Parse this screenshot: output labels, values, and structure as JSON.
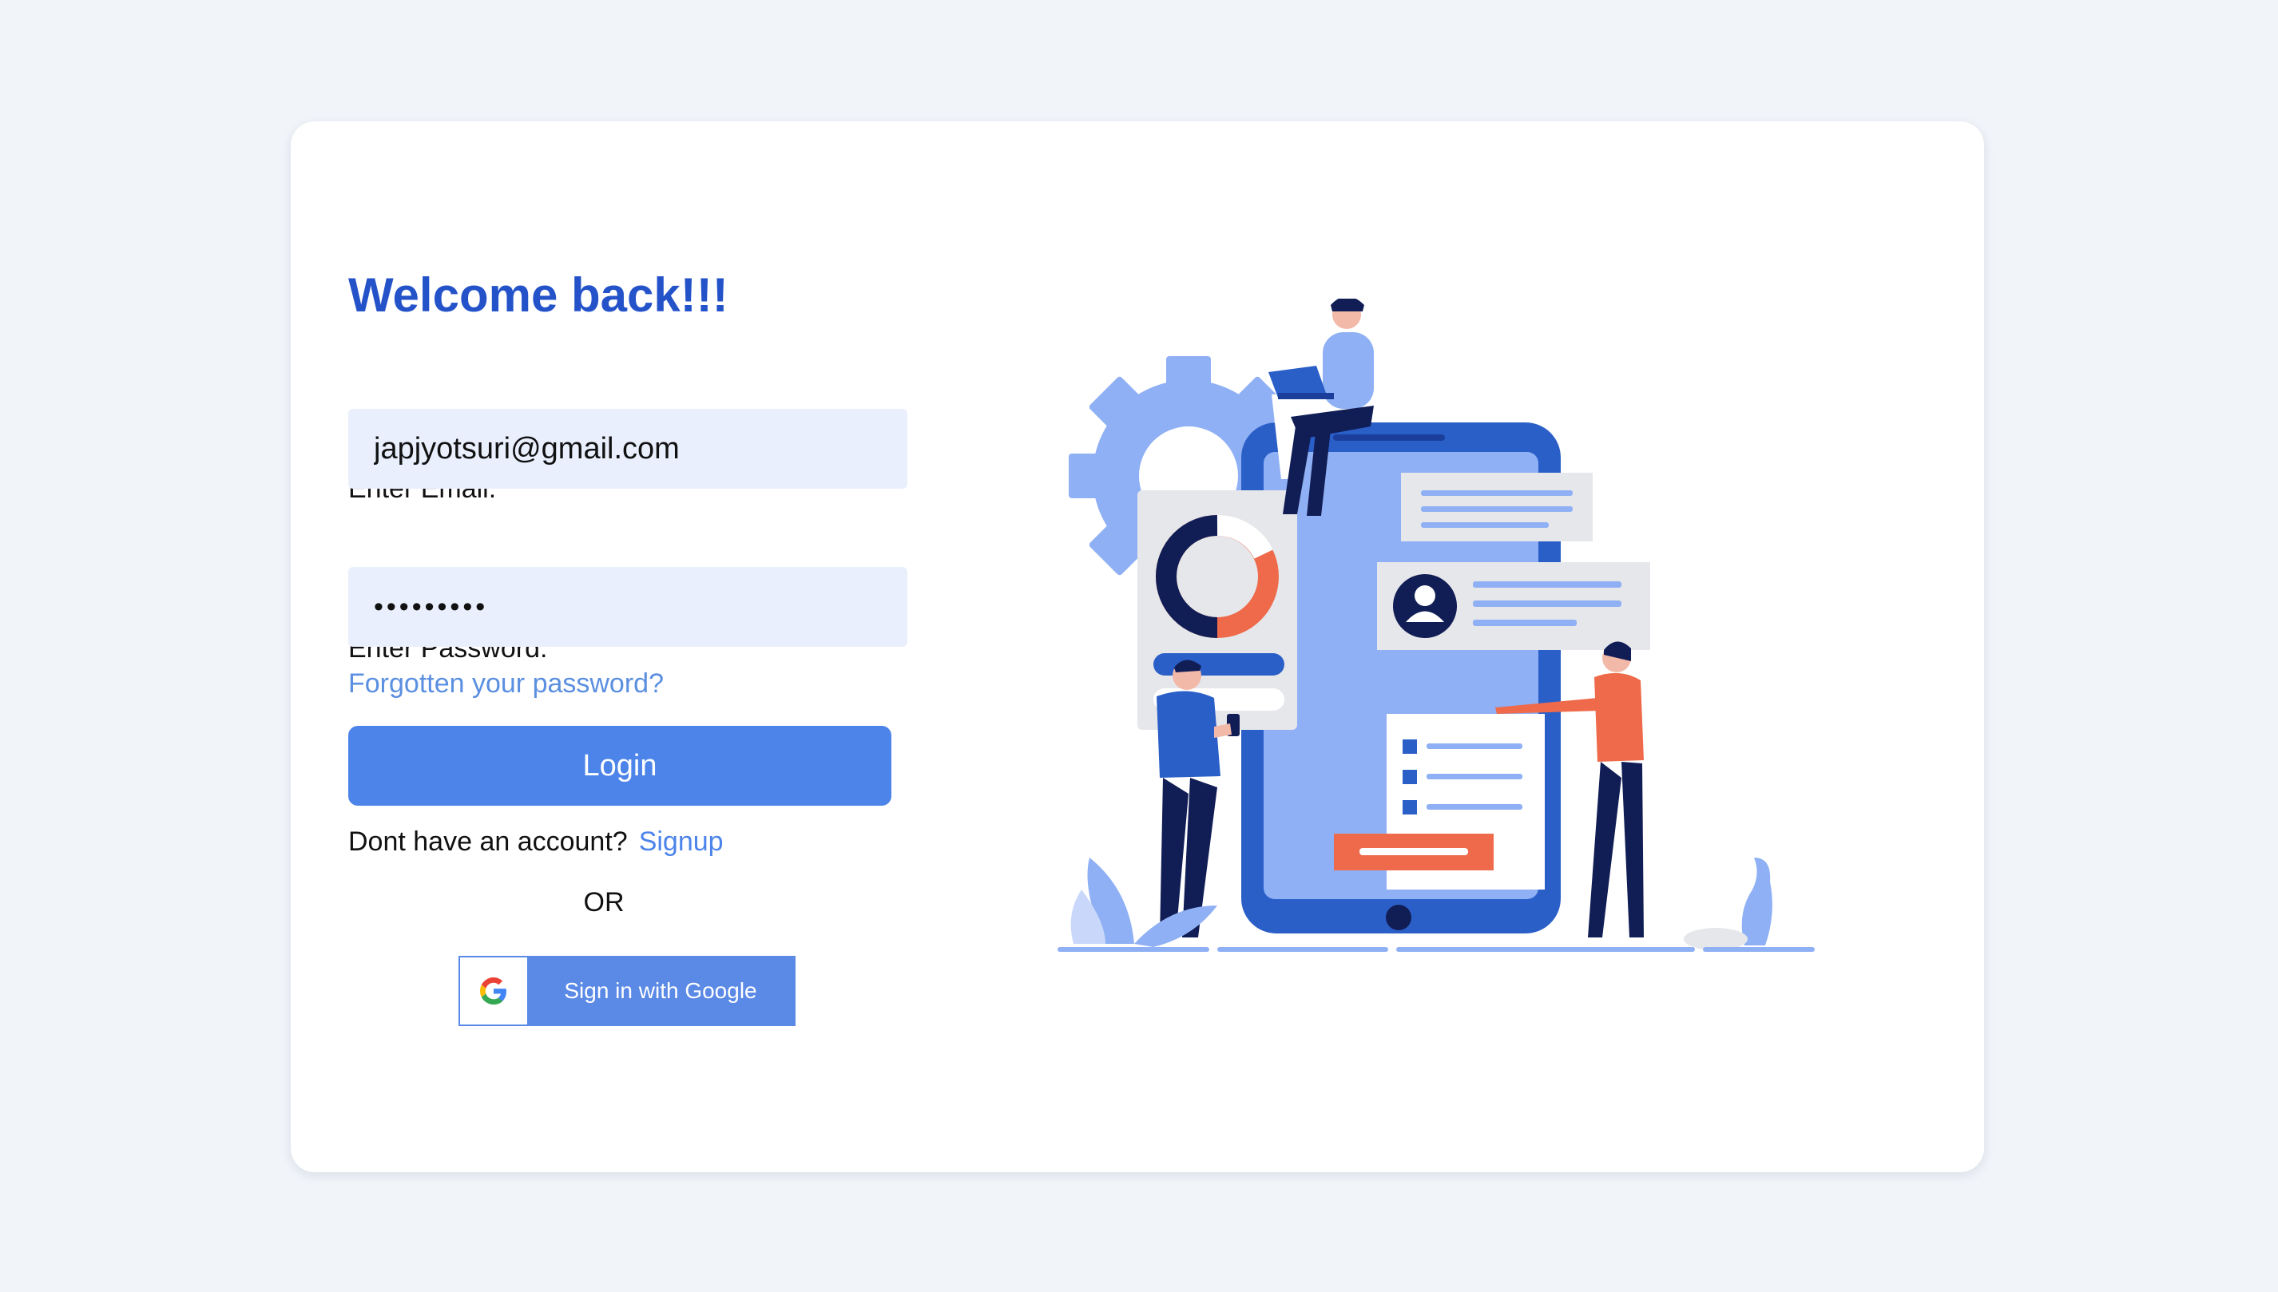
{
  "login": {
    "title": "Welcome back!!!",
    "email_label": "Enter Email:",
    "email_value": "japjyotsuri@gmail.com",
    "password_label": "Enter Password:",
    "password_value": "•••••••••",
    "forgot_link": "Forgotten your password?",
    "login_button": "Login",
    "no_account_text": "Dont have an account?",
    "signup_link": "Signup",
    "or_text": "OR",
    "google_button": "Sign in with Google",
    "google_icon": "google-g-logo"
  },
  "illustration": {
    "name": "mobile-app-team-illustration"
  },
  "colors": {
    "page_bg": "#f1f4f9",
    "card_bg": "#ffffff",
    "title": "#2453c9",
    "input_bg": "#e9effd",
    "link": "#5b8fe0",
    "primary_button": "#4c84ea",
    "google_button": "#5b89e6",
    "illustration_dark": "#2b5fc8",
    "illustration_light": "#8fb0f4",
    "illustration_accent": "#ee6a4a",
    "illustration_navy": "#111d55"
  }
}
